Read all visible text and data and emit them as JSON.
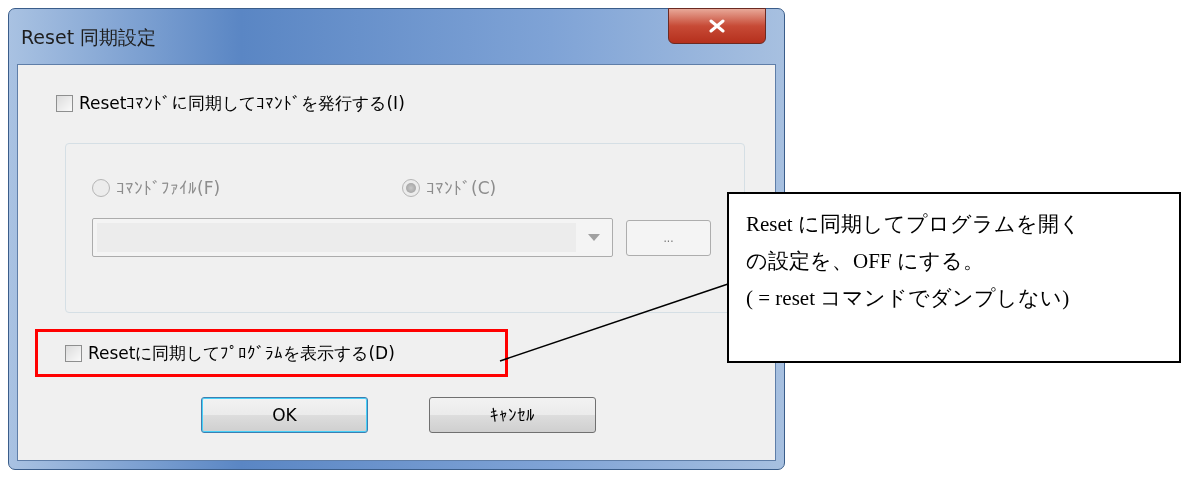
{
  "window": {
    "title": "Reset 同期設定"
  },
  "sync_command_checkbox": {
    "label": "Resetｺﾏﾝﾄﾞに同期してｺﾏﾝﾄﾞを発行する(I)",
    "checked": false
  },
  "command_group": {
    "disabled": true,
    "browse_button": "...",
    "radios": [
      {
        "label": "ｺﾏﾝﾄﾞﾌｧｲﾙ(F)",
        "selected": false
      },
      {
        "label": "ｺﾏﾝﾄﾞ(C)",
        "selected": true
      }
    ]
  },
  "show_program_checkbox": {
    "label": "Resetに同期してﾌﾟﾛｸﾞﾗﾑを表示する(D)",
    "checked": false,
    "highlighted": true
  },
  "buttons": [
    {
      "label": "OK",
      "default": true
    },
    {
      "label": "ｷｬﾝｾﾙ",
      "default": false
    }
  ],
  "callout": {
    "lines": [
      "Reset に同期してプログラムを開く",
      "の設定を、OFF にする。",
      "( = reset コマンドでダンプしない)"
    ]
  }
}
